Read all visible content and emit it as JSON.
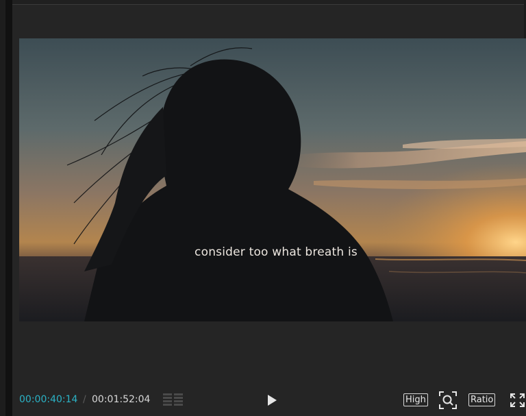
{
  "preview": {
    "caption": "consider too what breath is"
  },
  "playback": {
    "current_time": "00:00:40:14",
    "separator": "/",
    "total_time": "00:01:52:04"
  },
  "controls": {
    "grid_icon": "waveform-grid-icon",
    "play_icon": "play-icon",
    "quality_label": "High",
    "zoom_icon": "zoom-fit-icon",
    "ratio_label": "Ratio",
    "fullscreen_icon": "fullscreen-icon"
  },
  "colors": {
    "background": "#252525",
    "timecode_accent": "#2bb3c6",
    "caption_text": "#ece6df"
  }
}
